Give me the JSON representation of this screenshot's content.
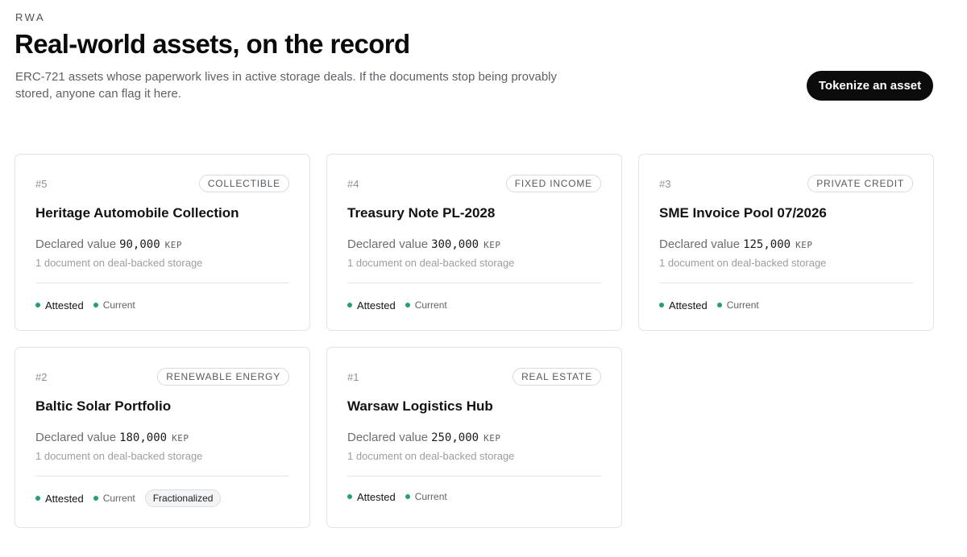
{
  "header": {
    "eyebrow": "RWA",
    "title": "Real-world assets, on the record",
    "subtitle": "ERC-721 assets whose paperwork lives in active storage deals. If the documents stop being provably stored, anyone can flag it here.",
    "cta_label": "Tokenize an asset"
  },
  "colors": {
    "status_dot": "#1fa36b",
    "cta_bg": "#0c0c0c"
  },
  "assets": [
    {
      "id": "#5",
      "category": "COLLECTIBLE",
      "title": "Heritage Automobile Collection",
      "value_label": "Declared value",
      "value": "90,000",
      "unit": "KEP",
      "docs": "1 document on deal-backed storage",
      "attested": "Attested",
      "current": "Current",
      "fractionalized": ""
    },
    {
      "id": "#4",
      "category": "FIXED INCOME",
      "title": "Treasury Note PL-2028",
      "value_label": "Declared value",
      "value": "300,000",
      "unit": "KEP",
      "docs": "1 document on deal-backed storage",
      "attested": "Attested",
      "current": "Current",
      "fractionalized": ""
    },
    {
      "id": "#3",
      "category": "PRIVATE CREDIT",
      "title": "SME Invoice Pool 07/2026",
      "value_label": "Declared value",
      "value": "125,000",
      "unit": "KEP",
      "docs": "1 document on deal-backed storage",
      "attested": "Attested",
      "current": "Current",
      "fractionalized": ""
    },
    {
      "id": "#2",
      "category": "RENEWABLE ENERGY",
      "title": "Baltic Solar Portfolio",
      "value_label": "Declared value",
      "value": "180,000",
      "unit": "KEP",
      "docs": "1 document on deal-backed storage",
      "attested": "Attested",
      "current": "Current",
      "fractionalized": "Fractionalized"
    },
    {
      "id": "#1",
      "category": "REAL ESTATE",
      "title": "Warsaw Logistics Hub",
      "value_label": "Declared value",
      "value": "250,000",
      "unit": "KEP",
      "docs": "1 document on deal-backed storage",
      "attested": "Attested",
      "current": "Current",
      "fractionalized": ""
    }
  ]
}
